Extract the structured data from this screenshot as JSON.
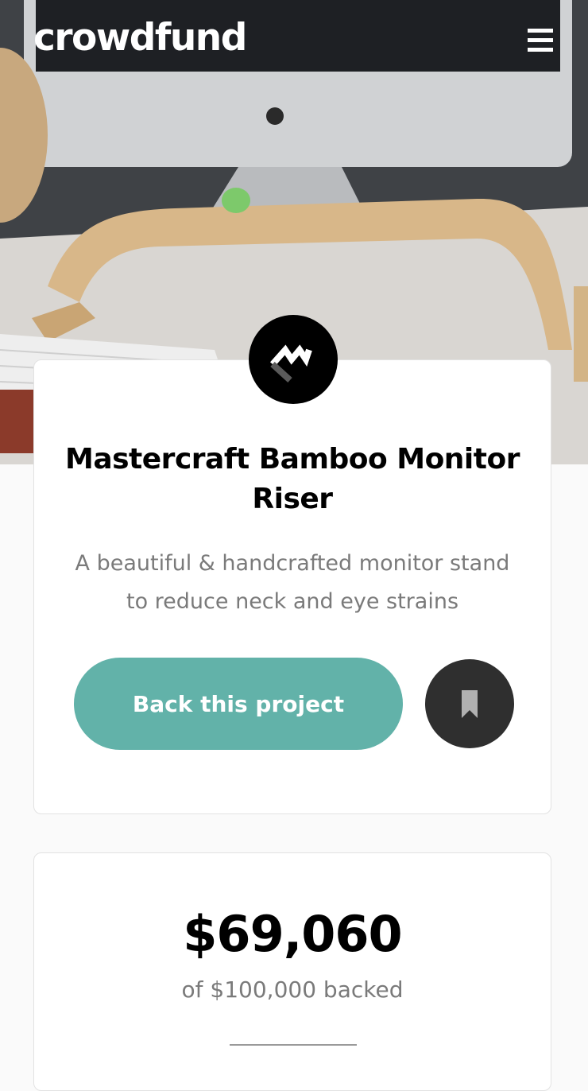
{
  "header": {
    "logo_text": "crowdfund",
    "menu_icon": "hamburger-menu-icon"
  },
  "hero": {
    "image_description_icon": "hero-desk-photo"
  },
  "project": {
    "brand_icon": "mastercraft-logo-icon",
    "title": "Mastercraft Bamboo Monitor Riser",
    "description": "A beautiful & handcrafted monitor stand to reduce neck and eye strains",
    "back_button_label": "Back this project",
    "bookmark_icon": "bookmark-icon"
  },
  "stats": {
    "amount_backed": "$69,060",
    "amount_backed_sub": "of $100,000 backed"
  },
  "colors": {
    "accent": "#62b2a9",
    "dark": "#2f2f2f",
    "muted_text": "#7a7a7a"
  }
}
